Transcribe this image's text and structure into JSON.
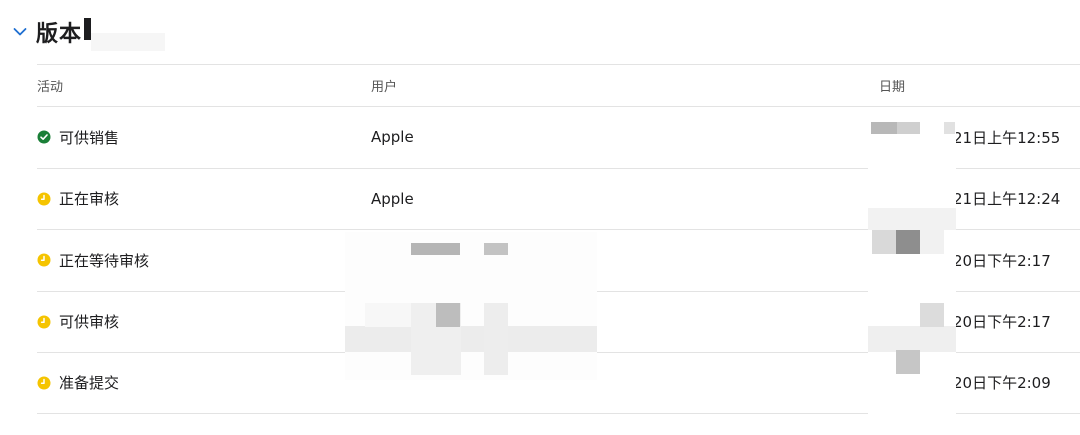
{
  "section": {
    "title": "版本",
    "collapse_icon": "chevron-down-icon"
  },
  "table": {
    "columns": [
      "活动",
      "用户",
      "日期"
    ],
    "rows": [
      {
        "status": "可供销售",
        "icon": "check-circle-icon",
        "color": "#1a7f37",
        "user": "Apple",
        "date": "21日上午12:55"
      },
      {
        "status": "正在审核",
        "icon": "clock-icon",
        "color": "#f5c400",
        "user": "Apple",
        "date": "21日上午12:24"
      },
      {
        "status": "正在等待审核",
        "icon": "clock-icon",
        "color": "#f5c400",
        "user": "",
        "date": "20日下午2:17"
      },
      {
        "status": "可供审核",
        "icon": "clock-icon",
        "color": "#f5c400",
        "user": "",
        "date": "20日下午2:17"
      },
      {
        "status": "准备提交",
        "icon": "clock-icon",
        "color": "#f5c400",
        "user": "",
        "date": "20日下午2:09"
      }
    ]
  }
}
